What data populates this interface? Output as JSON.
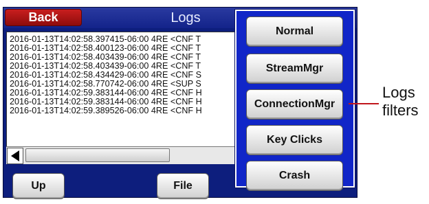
{
  "header": {
    "back_label": "Back",
    "title": "Logs"
  },
  "log_lines": [
    "2016-01-13T14:02:58.397415-06:00 4RE <CNF T",
    "2016-01-13T14:02:58.400123-06:00 4RE <CNF T",
    "2016-01-13T14:02:58.403439-06:00 4RE <CNF T",
    "2016-01-13T14:02:58.403439-06:00 4RE <CNF T",
    "2016-01-13T14:02:58.434429-06:00 4RE <CNF S",
    "2016-01-13T14:02:58.770742-06:00 4RE <SUP S",
    "2016-01-13T14:02:59.383144-06:00 4RE <CNF H",
    "2016-01-13T14:02:59.383144-06:00 4RE <CNF H",
    "2016-01-13T14:02:59.389526-06:00 4RE <CNF H"
  ],
  "footer": {
    "up_label": "Up",
    "file_label": "File"
  },
  "filter_menu": {
    "items": [
      "Normal",
      "StreamMgr",
      "ConnectionMgr",
      "Key Clicks",
      "Crash"
    ]
  },
  "annotation": {
    "line1": "Logs",
    "line2": "filters"
  },
  "icons": {
    "scroll_left": "left-arrow-icon"
  },
  "colors": {
    "device_bg": "#0d1e7d",
    "back_button": "#b01414",
    "menu_bg": "#1126c8",
    "callout": "#c0151b"
  }
}
